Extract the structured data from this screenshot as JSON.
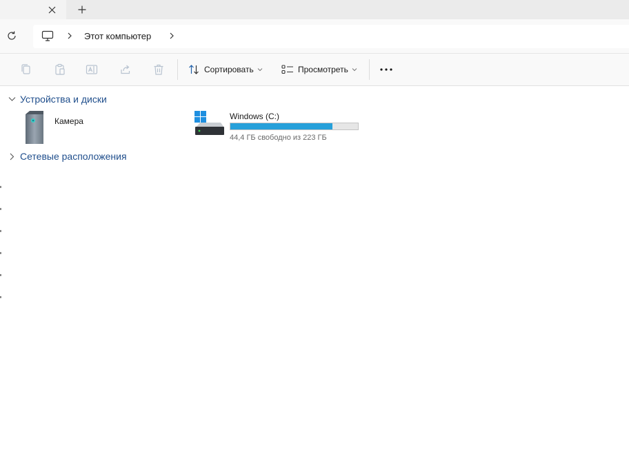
{
  "tabbar": {
    "close_icon": "close-icon",
    "new_tab_icon": "plus-icon"
  },
  "address": {
    "breadcrumb_root_icon": "computer-icon",
    "breadcrumb_label": "Этот компьютер"
  },
  "toolbar": {
    "sort_label": "Сортировать",
    "view_label": "Просмотреть"
  },
  "sections": {
    "devices": {
      "label": "Устройства и диски",
      "items": [
        {
          "name": "Камера",
          "icon": "tower-device-icon"
        }
      ],
      "drive": {
        "name": "Windows (C:)",
        "free_text": "44,4 ГБ свободно из 223 ГБ",
        "used_fraction": 0.8,
        "bar_color": "#26a0da"
      }
    },
    "network": {
      "label": "Сетевые расположения"
    }
  }
}
